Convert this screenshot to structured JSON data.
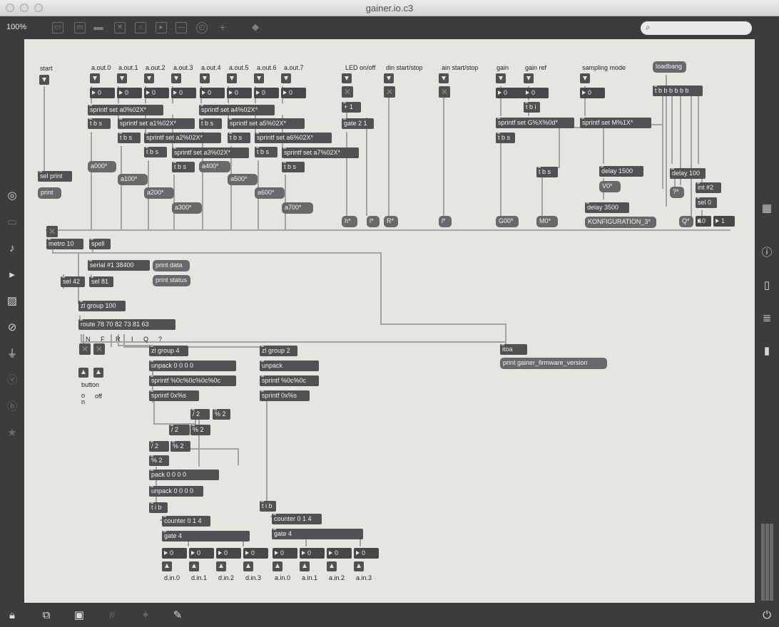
{
  "window": {
    "title": "gainer.io.c3"
  },
  "toolbar": {
    "zoom": "100%",
    "search_placeholder": ""
  },
  "objects": {
    "sel_print": "sel print",
    "metro": "metro 10",
    "spell": "spell",
    "serial": "serial #1 38400",
    "sel42": "sel 42",
    "sel81": "sel 81",
    "zl100": "zl group 100",
    "route": "route 78 70 82 73 81 63",
    "zl4": "zl group 4",
    "unpack4": "unpack 0 0 0 0",
    "sprintf_c4": "sprintf %0c%0c%0c%0c",
    "sprintf_s1": "sprintf 0x%s",
    "div1": "/ 2",
    "mod1": "% 2",
    "div2": "/ 2",
    "mod2": "% 2",
    "div3": "/ 2",
    "mod3": "% 2",
    "pack": "pack 0 0 0 0",
    "unpack4b": "unpack 0 0 0 0",
    "tib1": "t i b",
    "counter1": "counter 0 1 4",
    "gate4a": "gate 4",
    "zl2": "zl group 2",
    "unpack": "unpack",
    "sprintf_c2": "sprintf %0c%0c",
    "sprintf_s2": "sprintf 0x%s",
    "tib2": "t i b",
    "counter2": "counter 0 1 4",
    "gate4b": "gate 4",
    "itoa": "itoa",
    "gate21": "gate 2 1",
    "plus1": "+ 1",
    "sprintf_gain": "sprintf set G%X%0d*",
    "tib3": "t b i",
    "tbs_gain": "t b s",
    "sprintf_mode": "sprintf set M%1X*",
    "tbs_mode": "t b s",
    "tbbb": "t b b b b b b",
    "delay1500": "delay 1500",
    "delay3500": "delay 3500",
    "delay100": "delay 100",
    "int2": "int #2",
    "sel0": "sel 0",
    "num10": "10",
    "sp": [
      "sprintf set a0%02X*",
      "sprintf set a1%02X*",
      "sprintf set a2%02X*",
      "sprintf set a3%02X*",
      "sprintf set a4%02X*",
      "sprintf set a5%02X*",
      "sprintf set a6%02X*",
      "sprintf set a7%02X*"
    ],
    "tbs": [
      "t b s",
      "t b s",
      "t b s",
      "t b s",
      "t b s",
      "t b s",
      "t b s",
      "t b s"
    ]
  },
  "messages": {
    "print": "print",
    "print_data": "print data",
    "print_status": "print status",
    "print_fw": "print gainer_firmware_version",
    "loadbang": "loadbang",
    "h": "h*",
    "l1": "l*",
    "R": "R*",
    "l2": "l*",
    "G00": "G00*",
    "M0": "M0*",
    "V0": "V0*",
    "konfig": "KONFIGURATION_3*",
    "q": "?*",
    "Q": "Q*",
    "a": [
      "a000*",
      "a100*",
      "a200*",
      "a300*",
      "a400*",
      "a500*",
      "a600*",
      "a700*"
    ]
  },
  "labels": {
    "start": "start",
    "aout": [
      "a.out.0",
      "a.out.1",
      "a.out.2",
      "a.out.3",
      "a.out.4",
      "a.out.5",
      "a.out.6",
      "a.out.7"
    ],
    "led": "LED on/off",
    "din": "din start/stop",
    "ain": "ain start/stop",
    "gain": "gain",
    "gainref": "gain ref",
    "sampling": "sampling mode",
    "button": "button",
    "on": "o\nn",
    "off": "off",
    "dout": [
      "d.in.0",
      "d.in.1",
      "d.in.2",
      "d.in.3"
    ],
    "aouts": [
      "a.in.0",
      "a.in.1",
      "a.in.2",
      "a.in.3"
    ],
    "route_letters": [
      "N",
      "F",
      "R",
      "I",
      "Q",
      "?"
    ],
    "one": "1"
  },
  "numbers": {
    "zero": "0"
  }
}
